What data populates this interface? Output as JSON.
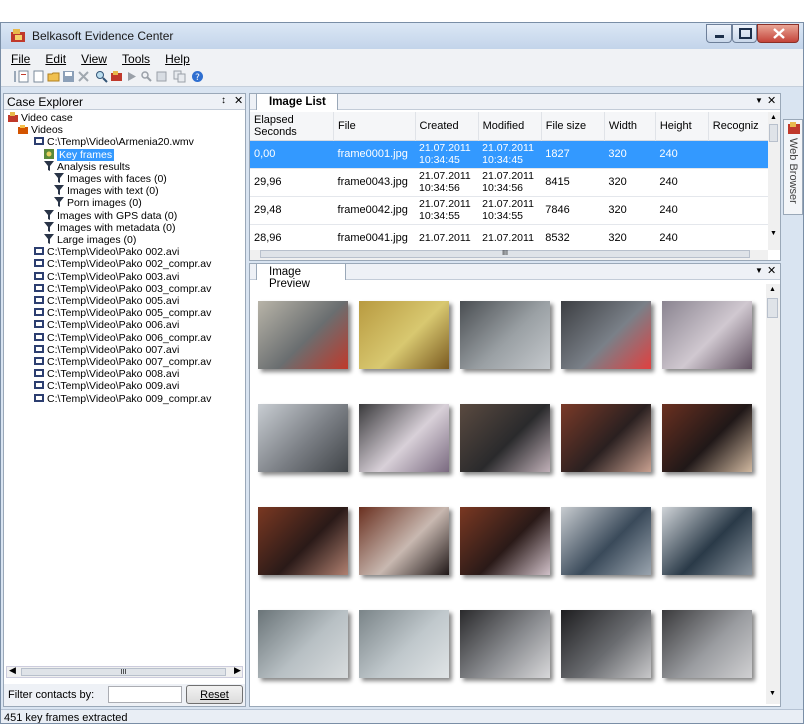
{
  "app": {
    "title": "Belkasoft Evidence Center"
  },
  "menu": [
    "File",
    "Edit",
    "View",
    "Tools",
    "Help"
  ],
  "case_explorer": {
    "title": "Case Explorer",
    "pin": "↕",
    "close": "✕",
    "tree": [
      {
        "label": "Video case",
        "depth": 0,
        "icon": "case-icon"
      },
      {
        "label": "Videos",
        "depth": 1,
        "icon": "folder-icon"
      },
      {
        "label": "C:\\Temp\\Video\\Armenia20.wmv",
        "depth": 2,
        "icon": "video-icon"
      },
      {
        "label": "Key frames",
        "depth": 3,
        "icon": "keyframe-icon",
        "selected": true
      },
      {
        "label": "Analysis results",
        "depth": 3,
        "icon": "filter-icon"
      },
      {
        "label": "Images with faces (0)",
        "depth": 4,
        "icon": "filter-icon"
      },
      {
        "label": "Images with text (0)",
        "depth": 4,
        "icon": "filter-icon"
      },
      {
        "label": "Porn images (0)",
        "depth": 4,
        "icon": "filter-icon"
      },
      {
        "label": "Images with GPS data (0)",
        "depth": 3,
        "icon": "filter-icon"
      },
      {
        "label": "Images with metadata (0)",
        "depth": 3,
        "icon": "filter-icon"
      },
      {
        "label": "Large images (0)",
        "depth": 3,
        "icon": "filter-icon"
      },
      {
        "label": "C:\\Temp\\Video\\Pako 002.avi",
        "depth": 2,
        "icon": "video-icon"
      },
      {
        "label": "C:\\Temp\\Video\\Pako 002_compr.av",
        "depth": 2,
        "icon": "video-icon"
      },
      {
        "label": "C:\\Temp\\Video\\Pako 003.avi",
        "depth": 2,
        "icon": "video-icon"
      },
      {
        "label": "C:\\Temp\\Video\\Pako 003_compr.av",
        "depth": 2,
        "icon": "video-icon"
      },
      {
        "label": "C:\\Temp\\Video\\Pako 005.avi",
        "depth": 2,
        "icon": "video-icon"
      },
      {
        "label": "C:\\Temp\\Video\\Pako 005_compr.av",
        "depth": 2,
        "icon": "video-icon"
      },
      {
        "label": "C:\\Temp\\Video\\Pako 006.avi",
        "depth": 2,
        "icon": "video-icon"
      },
      {
        "label": "C:\\Temp\\Video\\Pako 006_compr.av",
        "depth": 2,
        "icon": "video-icon"
      },
      {
        "label": "C:\\Temp\\Video\\Pako 007.avi",
        "depth": 2,
        "icon": "video-icon"
      },
      {
        "label": "C:\\Temp\\Video\\Pako 007_compr.av",
        "depth": 2,
        "icon": "video-icon"
      },
      {
        "label": "C:\\Temp\\Video\\Pako 008.avi",
        "depth": 2,
        "icon": "video-icon"
      },
      {
        "label": "C:\\Temp\\Video\\Pako 009.avi",
        "depth": 2,
        "icon": "video-icon"
      },
      {
        "label": "C:\\Temp\\Video\\Pako 009_compr.av",
        "depth": 2,
        "icon": "video-icon"
      }
    ],
    "filter_label": "Filter contacts by:",
    "filter_value": "",
    "reset": "Reset"
  },
  "image_list": {
    "tab": "Image List",
    "columns": [
      "Elapsed Seconds",
      "File",
      "Created",
      "Modified",
      "File size",
      "Width",
      "Height",
      "Recogniz"
    ],
    "rows": [
      [
        "0,00",
        "frame0001.jpg",
        "21.07.2011 10:34:45",
        "21.07.2011 10:34:45",
        "1827",
        "320",
        "240",
        ""
      ],
      [
        "29,96",
        "frame0043.jpg",
        "21.07.2011 10:34:56",
        "21.07.2011 10:34:56",
        "8415",
        "320",
        "240",
        ""
      ],
      [
        "29,48",
        "frame0042.jpg",
        "21.07.2011 10:34:55",
        "21.07.2011 10:34:55",
        "7846",
        "320",
        "240",
        ""
      ],
      [
        "28,96",
        "frame0041.jpg",
        "21.07.2011",
        "21.07.2011",
        "8532",
        "320",
        "240",
        ""
      ]
    ],
    "selected_row": 0
  },
  "image_preview": {
    "tab": "Image Preview"
  },
  "side_tab": "Web Browser",
  "status": "451 key frames extracted",
  "colors": {
    "selection": "#3399ff",
    "title_bg": "#c3d4ea",
    "close_btn": "#c4443a"
  }
}
